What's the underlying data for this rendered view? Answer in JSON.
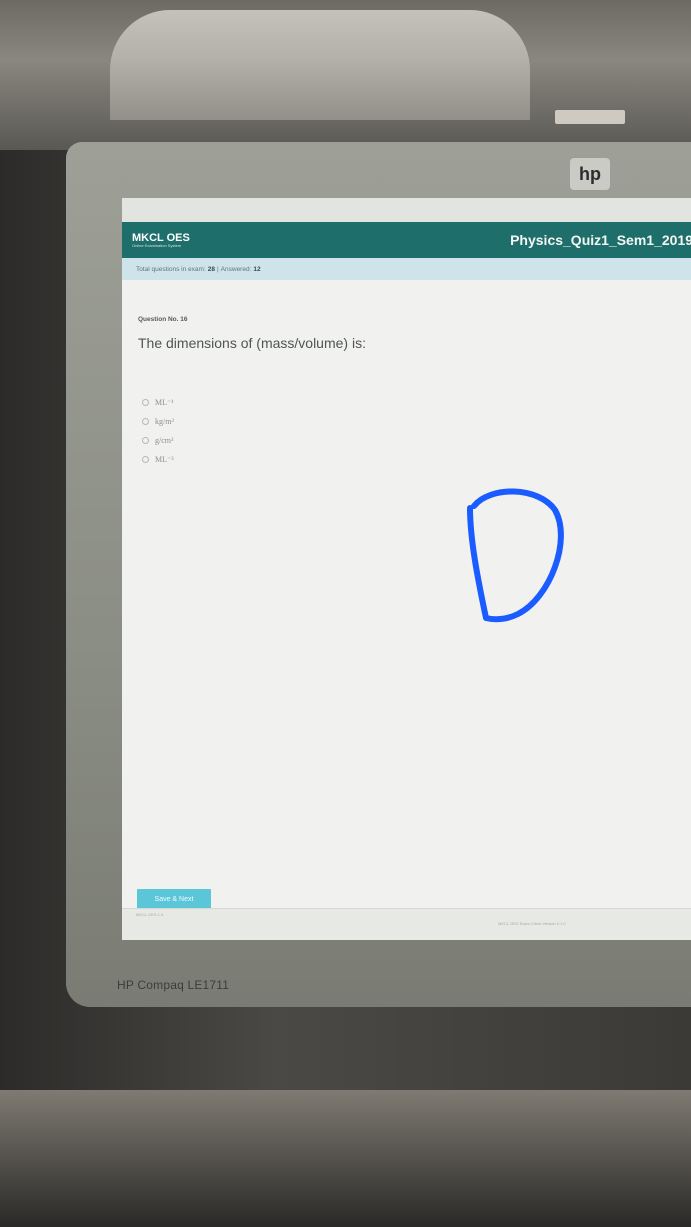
{
  "monitor": {
    "brand_label": "HP Compaq LE1711",
    "logo_glyph": "hp"
  },
  "app": {
    "logo_text": "MKCL OES",
    "logo_subtext": "Online Examination System",
    "quiz_title": "Physics_Quiz1_Sem1_2019",
    "status": {
      "total_label": "Total questions in exam:",
      "total_value": "28",
      "separator": "|",
      "answered_label": "Answered:",
      "answered_value": "12"
    },
    "question": {
      "number_label": "Question No. 16",
      "text": "The dimensions of (mass/volume) is:",
      "options": [
        "ML⁻¹",
        "kg/m³",
        "g/cm³",
        "ML⁻³"
      ]
    },
    "save_button_label": "Save & Next",
    "footer_left": "MKCL OES 1.0",
    "footer_right": "MKCL OES Exam Client Version 2.1.0"
  },
  "annotation": {
    "handwritten_letter": "D",
    "color": "#1a5cff"
  }
}
